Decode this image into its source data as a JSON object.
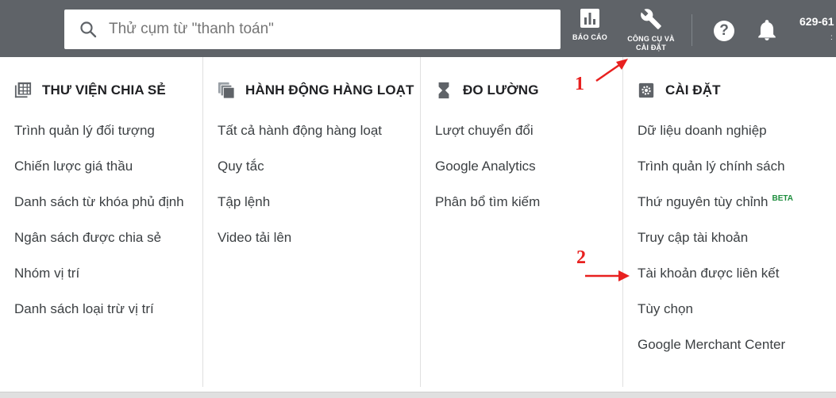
{
  "search": {
    "placeholder": "Thử cụm từ \"thanh toán\""
  },
  "toolbar": {
    "reports_label": "BÁO CÁO",
    "tools_label_line1": "CÔNG CỤ VÀ",
    "tools_label_line2": "CÀI ĐẶT",
    "help_glyph": "?",
    "account_id": "629-61",
    "account_sub": ":"
  },
  "columns": [
    {
      "title": "THƯ VIỆN CHIA SẺ",
      "icon": "library-icon",
      "items": [
        "Trình quản lý đối tượng",
        "Chiến lược giá thầu",
        "Danh sách từ khóa phủ định",
        "Ngân sách được chia sẻ",
        "Nhóm vị trí",
        "Danh sách loại trừ vị trí"
      ]
    },
    {
      "title": "HÀNH ĐỘNG HÀNG LOẠT",
      "icon": "bulk-actions-icon",
      "items": [
        "Tất cả hành động hàng loạt",
        "Quy tắc",
        "Tập lệnh",
        "Video tải lên"
      ]
    },
    {
      "title": "ĐO LƯỜNG",
      "icon": "hourglass-icon",
      "items": [
        "Lượt chuyển đổi",
        "Google Analytics",
        "Phân bổ tìm kiếm"
      ]
    },
    {
      "title": "CÀI ĐẶT",
      "icon": "settings-icon",
      "items": [
        "Dữ liệu doanh nghiệp",
        "Trình quản lý chính sách",
        "Thứ nguyên tùy chỉnh",
        "Truy cập tài khoản",
        "Tài khoản được liên kết",
        "Tùy chọn",
        "Google Merchant Center"
      ],
      "beta_label": "BETA"
    }
  ],
  "annotations": {
    "step1": "1",
    "step2": "2",
    "color": "#e8201f"
  }
}
